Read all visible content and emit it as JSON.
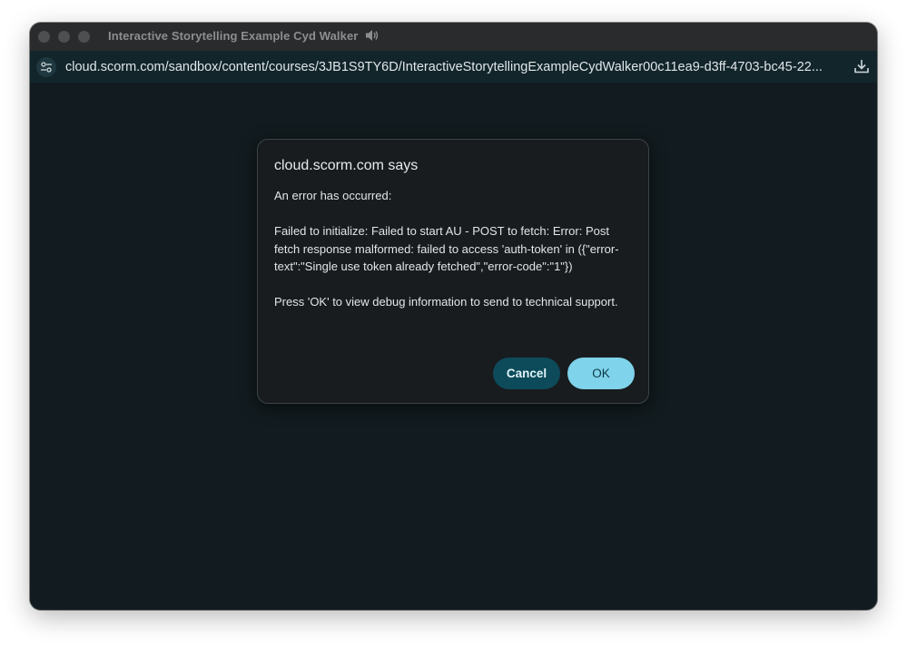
{
  "window": {
    "title": "Interactive Storytelling Example Cyd Walker"
  },
  "address_bar": {
    "url": "cloud.scorm.com/sandbox/content/courses/3JB1S9TY6D/InteractiveStorytellingExampleCydWalker00c11ea9-d3ff-4703-bc45-22..."
  },
  "dialog": {
    "title": "cloud.scorm.com says",
    "message_intro": "An error has occurred:",
    "message_error": "Failed to initialize: Failed to start AU -  POST to fetch: Error: Post fetch response malformed: failed to access 'auth-token' in ({\"error-text\":\"Single use token already fetched\",\"error-code\":\"1\"})",
    "message_prompt": "Press 'OK' to view debug information to send to technical support.",
    "cancel_label": "Cancel",
    "ok_label": "OK"
  },
  "colors": {
    "page_background": "#121b1f",
    "titlebar": "#2a2b2d",
    "addressbar": "#12252b",
    "dialog_background": "#181c1f",
    "cancel_button": "#0d4b5a",
    "ok_button": "#7fd3ea"
  },
  "icons": {
    "titlebar_audio": "speaker-icon",
    "site_info": "tune-icon",
    "download": "download-icon"
  }
}
